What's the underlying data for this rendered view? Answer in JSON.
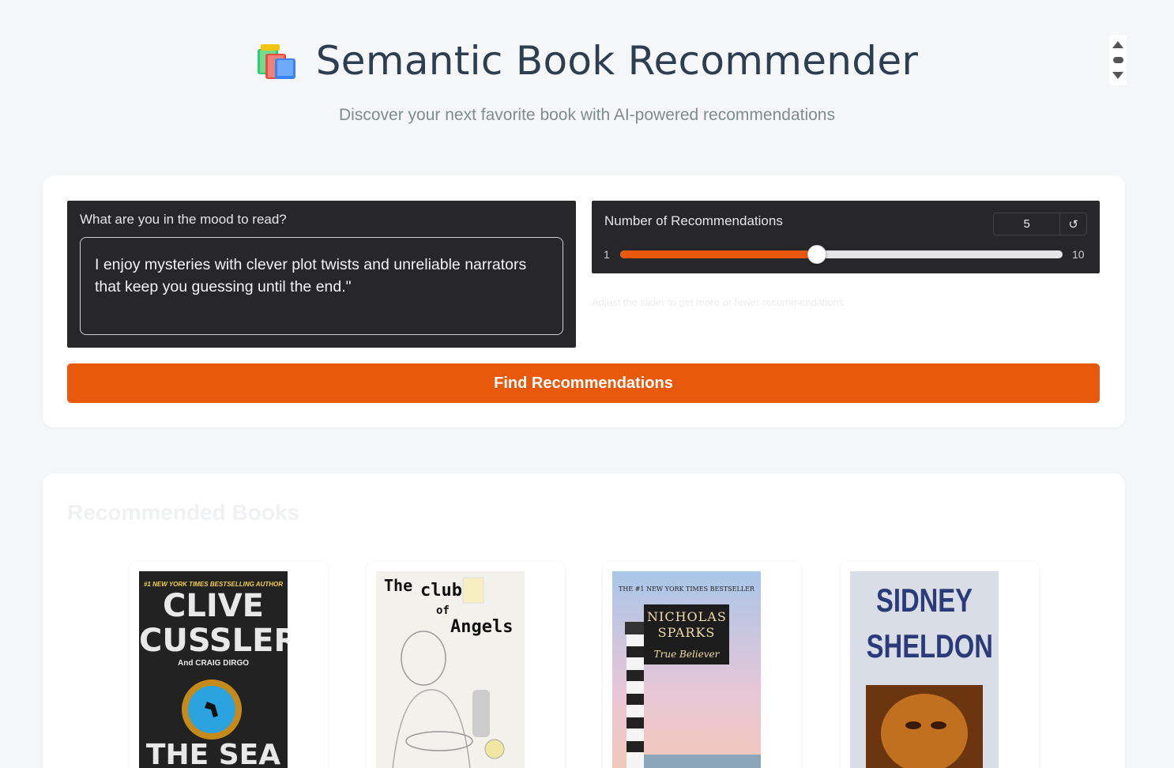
{
  "header": {
    "icon": "books-icon",
    "title": "Semantic Book Recommender",
    "subtitle": "Discover your next favorite book with AI-powered recommendations"
  },
  "query": {
    "label": "What are you in the mood to read?",
    "value": "I enjoy mysteries with clever plot twists and unreliable narrators that keep you guessing until the end.\""
  },
  "slider": {
    "label": "Number of Recommendations",
    "value": "5",
    "min": "1",
    "max": "10",
    "reset_icon": "↺",
    "hint": "Adjust the slider to get more or fewer recommendations"
  },
  "find_button": "Find Recommendations",
  "results": {
    "title": "Recommended Books",
    "books": [
      {
        "top": "#1 NEW YORK TIMES BESTSELLING AUTHOR",
        "author": "CLIVE CUSSLER",
        "coauthor": "And CRAIG DIRGO",
        "title": "THE SEA"
      },
      {
        "title1": "The",
        "title2": "club",
        "title3": "of",
        "title4": "Angels"
      },
      {
        "top": "THE #1 NEW YORK TIMES BESTSELLER",
        "author": "NICHOLAS SPARKS",
        "title": "True Believer"
      },
      {
        "author": "SIDNEY SHELDON"
      }
    ]
  },
  "colors": {
    "accent": "#e8590c",
    "panel": "#27272a",
    "background": "#f5f6f8"
  }
}
